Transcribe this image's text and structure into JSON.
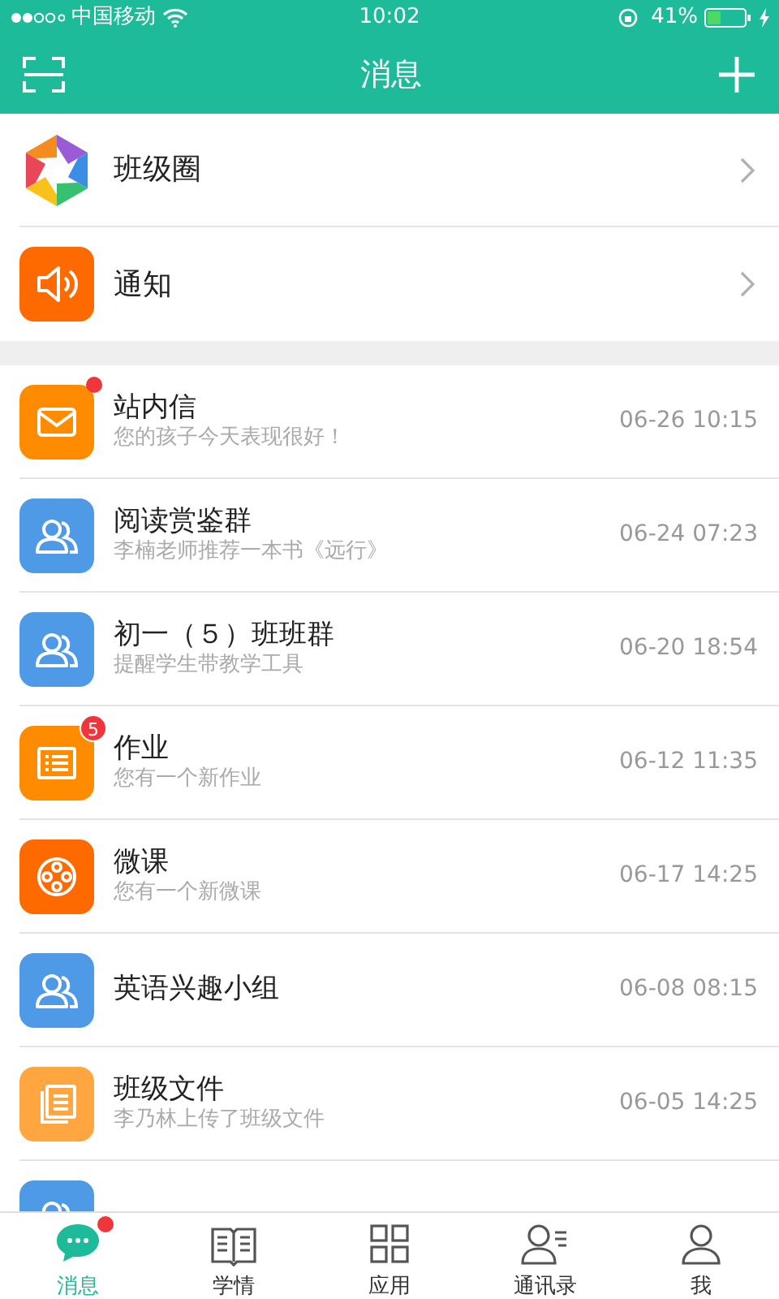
{
  "status_bar": {
    "carrier": "中国移动",
    "time": "10:02",
    "battery": "41%"
  },
  "header": {
    "title": "消息"
  },
  "shortcuts": [
    {
      "label": "班级圈",
      "kind": "aperture"
    },
    {
      "label": "通知",
      "kind": "speaker"
    }
  ],
  "messages": [
    {
      "title": "站内信",
      "preview": "您的孩子今天表现很好！",
      "time": "06-26 10:15",
      "kind": "mail",
      "color": "#ff8c00",
      "unread": true
    },
    {
      "title": "阅读赏鉴群",
      "preview": "李楠老师推荐一本书《远行》",
      "time": "06-24 07:23",
      "kind": "group",
      "color": "#4e9ae6",
      "unread": false
    },
    {
      "title": "初一（５）班班群",
      "preview": "提醒学生带教学工具",
      "time": "06-20 18:54",
      "kind": "group",
      "color": "#4e9ae6",
      "unread": false
    },
    {
      "title": "作业",
      "preview": "您有一个新作业",
      "time": "06-12 11:35",
      "kind": "list",
      "color": "#ff8c00",
      "unread": false,
      "badge": "5"
    },
    {
      "title": "微课",
      "preview": "您有一个新微课",
      "time": "06-17 14:25",
      "kind": "film",
      "color": "#ff6a00",
      "unread": false
    },
    {
      "title": "英语兴趣小组",
      "time": "06-08 08:15",
      "kind": "group",
      "color": "#4e9ae6",
      "unread": false
    },
    {
      "title": "班级文件",
      "preview": "李乃林上传了班级文件",
      "time": "06-05 14:25",
      "kind": "files",
      "color": "#ffa640",
      "unread": false
    },
    {
      "kind": "group",
      "color": "#4e9ae6",
      "unread": false
    }
  ],
  "tabs": [
    {
      "label": "消息",
      "kind": "chat",
      "selected": true,
      "unread": true
    },
    {
      "label": "学情",
      "kind": "book",
      "selected": false,
      "unread": false
    },
    {
      "label": "应用",
      "kind": "grid",
      "selected": false,
      "unread": false
    },
    {
      "label": "通讯录",
      "kind": "contacts",
      "selected": false,
      "unread": false
    },
    {
      "label": "我",
      "kind": "person",
      "selected": false,
      "unread": false
    }
  ]
}
